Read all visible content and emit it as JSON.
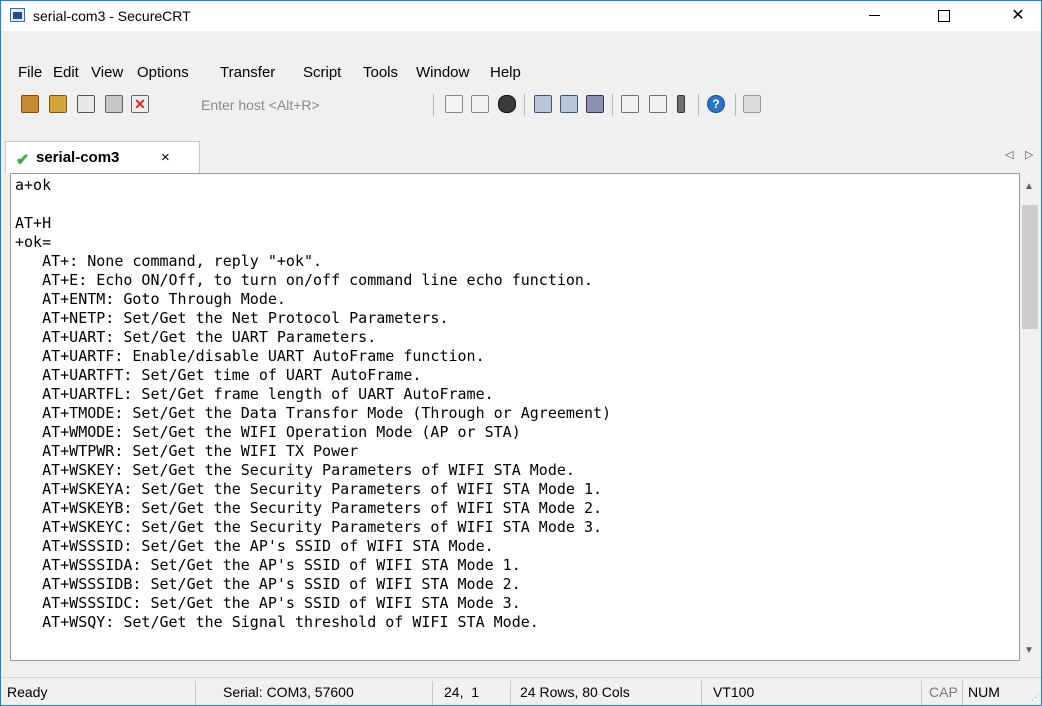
{
  "window": {
    "title": "serial-com3 - SecureCRT"
  },
  "menu": [
    "File",
    "Edit",
    "View",
    "Options",
    "Transfer",
    "Script",
    "Tools",
    "Window",
    "Help"
  ],
  "toolbar": {
    "host_placeholder": "Enter host <Alt+R>",
    "icons": [
      "connect-icon",
      "quick-connect-icon",
      "connect-in-tab-icon",
      "reconnect-icon",
      "disconnect-icon",
      "copy-icon",
      "paste-icon",
      "find-icon",
      "print-icon",
      "print-setup-icon",
      "print-screen-icon",
      "session-options-icon",
      "global-options-icon",
      "key-map-icon",
      "help-icon",
      "session-manager-icon"
    ]
  },
  "tab": {
    "label": "serial-com3",
    "close": "×"
  },
  "terminal": {
    "lines": [
      "a+ok",
      "",
      "AT+H",
      "+ok=",
      "   AT+: None command, reply \"+ok\".",
      "   AT+E: Echo ON/Off, to turn on/off command line echo function.",
      "   AT+ENTM: Goto Through Mode.",
      "   AT+NETP: Set/Get the Net Protocol Parameters.",
      "   AT+UART: Set/Get the UART Parameters.",
      "   AT+UARTF: Enable/disable UART AutoFrame function.",
      "   AT+UARTFT: Set/Get time of UART AutoFrame.",
      "   AT+UARTFL: Set/Get frame length of UART AutoFrame.",
      "   AT+TMODE: Set/Get the Data Transfor Mode (Through or Agreement)",
      "   AT+WMODE: Set/Get the WIFI Operation Mode (AP or STA)",
      "   AT+WTPWR: Set/Get the WIFI TX Power",
      "   AT+WSKEY: Set/Get the Security Parameters of WIFI STA Mode.",
      "   AT+WSKEYA: Set/Get the Security Parameters of WIFI STA Mode 1.",
      "   AT+WSKEYB: Set/Get the Security Parameters of WIFI STA Mode 2.",
      "   AT+WSKEYC: Set/Get the Security Parameters of WIFI STA Mode 3.",
      "   AT+WSSSID: Set/Get the AP's SSID of WIFI STA Mode.",
      "   AT+WSSSIDA: Set/Get the AP's SSID of WIFI STA Mode 1.",
      "   AT+WSSSIDB: Set/Get the AP's SSID of WIFI STA Mode 2.",
      "   AT+WSSSIDC: Set/Get the AP's SSID of WIFI STA Mode 3.",
      "   AT+WSQY: Set/Get the Signal threshold of WIFI STA Mode."
    ]
  },
  "status": {
    "ready": "Ready",
    "serial": "Serial: COM3, 57600",
    "cursor": "24,  1",
    "size": "24 Rows, 80 Cols",
    "emulation": "VT100",
    "cap": "CAP",
    "num": "NUM"
  },
  "colors": {
    "accent": "#1883d7",
    "connected": "#3caa3c"
  }
}
